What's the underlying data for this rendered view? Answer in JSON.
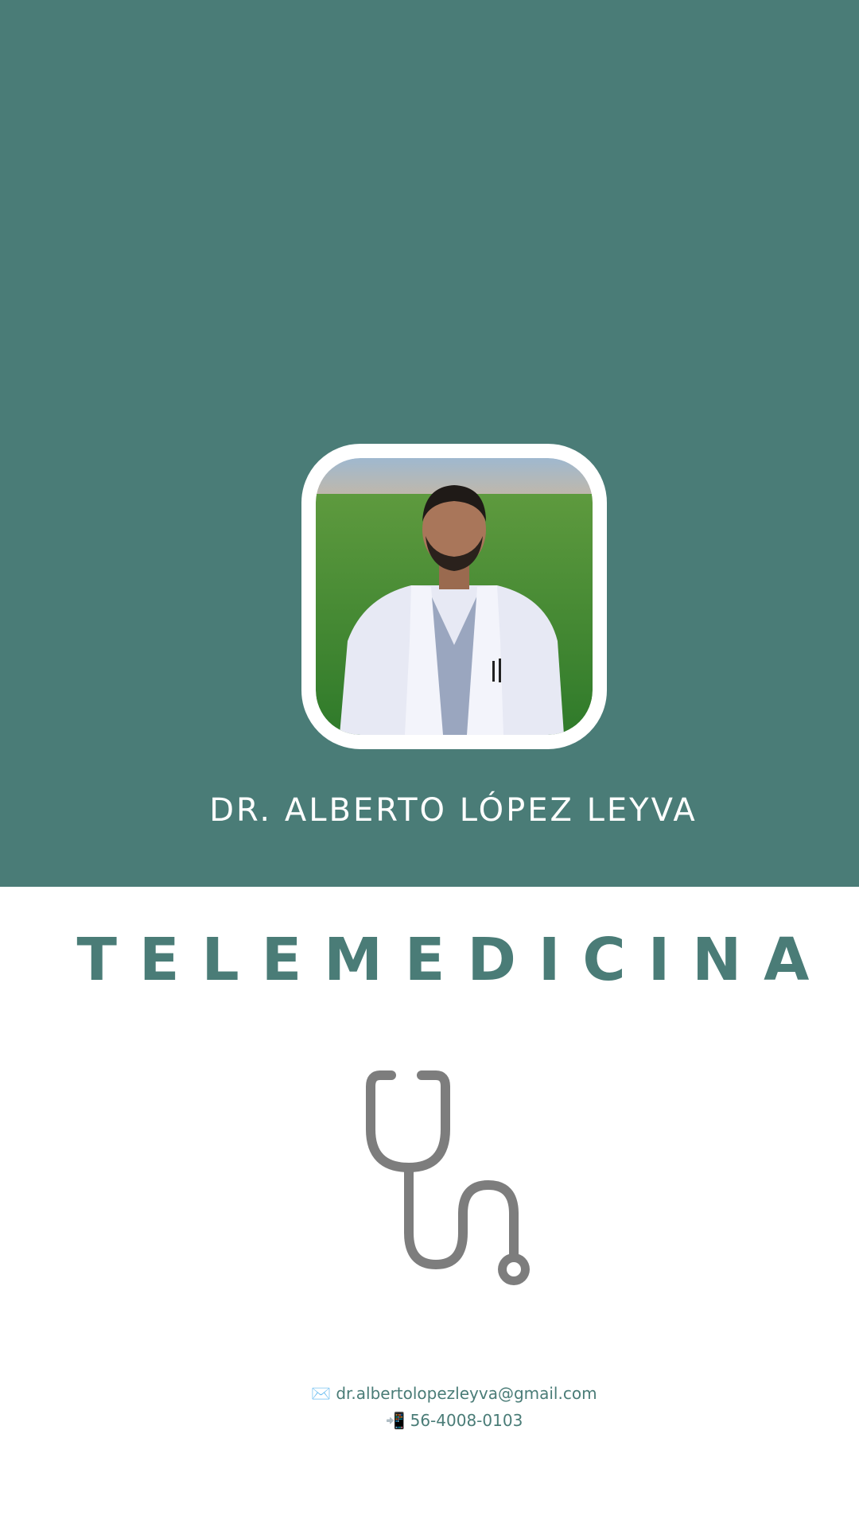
{
  "profile": {
    "name": "DR. ALBERTO LÓPEZ LEYVA",
    "photo_icon": "doctor-portrait"
  },
  "service": {
    "title": "TELEMEDICINA",
    "icon": "stethoscope-icon"
  },
  "contact": {
    "email_icon": "✉️",
    "email": "dr.albertolopezleyva@gmail.com",
    "phone_icon": "📲",
    "phone": "56-4008-0103"
  },
  "colors": {
    "brand": "#4a7c77",
    "icon_gray": "#7d7d7d",
    "background": "#ffffff"
  }
}
